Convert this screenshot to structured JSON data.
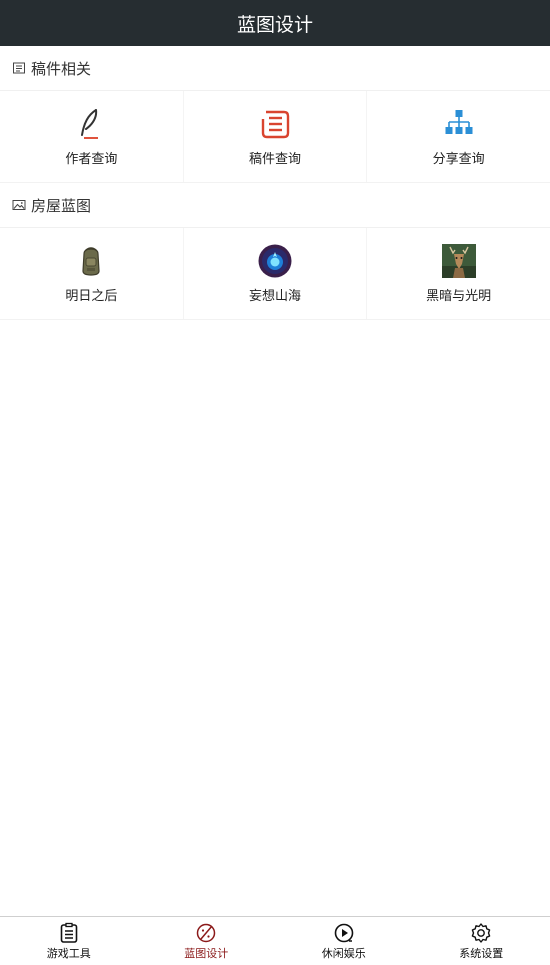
{
  "header": {
    "title": "蓝图设计"
  },
  "sections": [
    {
      "title": "稿件相关",
      "icon": "document-icon",
      "items": [
        {
          "label": "作者查询",
          "icon": "quill-pen-icon"
        },
        {
          "label": "稿件查询",
          "icon": "document-list-icon"
        },
        {
          "label": "分享查询",
          "icon": "sitemap-icon"
        }
      ]
    },
    {
      "title": "房屋蓝图",
      "icon": "image-icon",
      "items": [
        {
          "label": "明日之后",
          "icon": "backpack-game-icon"
        },
        {
          "label": "妄想山海",
          "icon": "blue-orb-game-icon"
        },
        {
          "label": "黑暗与光明",
          "icon": "deer-game-icon"
        }
      ]
    }
  ],
  "tabbar": {
    "tabs": [
      {
        "label": "游戏工具",
        "icon": "clipboard-icon",
        "active": false
      },
      {
        "label": "蓝图设计",
        "icon": "palette-icon",
        "active": true
      },
      {
        "label": "休闲娱乐",
        "icon": "play-circle-icon",
        "active": false
      },
      {
        "label": "系统设置",
        "icon": "gear-icon",
        "active": false
      }
    ]
  },
  "colors": {
    "header_bg": "#262d31",
    "active_tab": "#8b1a1a",
    "accent_red": "#d9442f",
    "accent_blue": "#2b8fd6"
  }
}
